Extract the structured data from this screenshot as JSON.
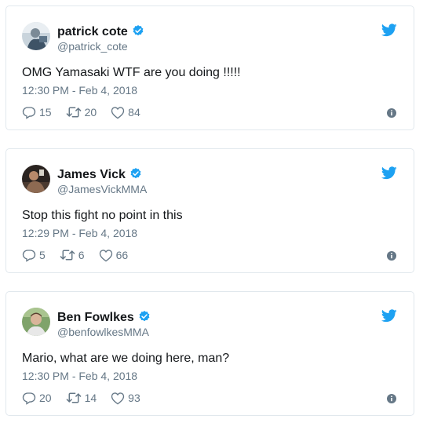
{
  "tweets": [
    {
      "name": "patrick cote",
      "handle": "@patrick_cote",
      "text": "OMG Yamasaki WTF are you doing !!!!!",
      "timestamp": "12:30 PM - Feb 4, 2018",
      "replies": "15",
      "retweets": "20",
      "likes": "84",
      "verified": true,
      "icons": [
        "reply-icon",
        "retweet-icon",
        "like-icon",
        "info-icon",
        "twitter-bird-icon",
        "verified-badge-icon"
      ]
    },
    {
      "name": "James Vick",
      "handle": "@JamesVickMMA",
      "text": "Stop this fight no point in this",
      "timestamp": "12:29 PM - Feb 4, 2018",
      "replies": "5",
      "retweets": "6",
      "likes": "66",
      "verified": true
    },
    {
      "name": "Ben Fowlkes",
      "handle": "@benfowlkesMMA",
      "text": "Mario, what are we doing here, man?",
      "timestamp": "12:30 PM - Feb 4, 2018",
      "replies": "20",
      "retweets": "14",
      "likes": "93",
      "verified": true
    }
  ],
  "colors": {
    "twitter_blue": "#1da1f2",
    "muted_text": "#657786",
    "border": "#e1e8ed",
    "primary_text": "#14171a"
  }
}
